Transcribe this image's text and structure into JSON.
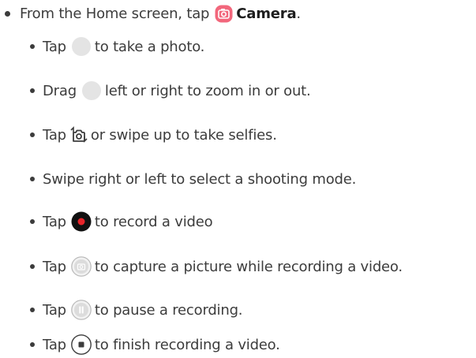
{
  "step_main": {
    "before": "From the Home screen, tap",
    "app_name": "Camera",
    "after": "."
  },
  "substeps": [
    {
      "before": "Tap",
      "after": "to take a photo.",
      "icon": "shutter-button-icon"
    },
    {
      "before": "Drag",
      "after": "left or right to zoom in or out.",
      "icon": "shutter-button-icon"
    },
    {
      "before": "Tap",
      "after": "or swipe up to take selfies.",
      "icon": "switch-camera-icon"
    },
    {
      "text": "Swipe right or left to select a shooting mode."
    },
    {
      "before": "Tap",
      "after": "to record a video",
      "icon": "record-button-icon"
    },
    {
      "before": "Tap",
      "after": "to capture a picture while recording a video.",
      "icon": "capture-button-icon"
    },
    {
      "before": "Tap",
      "after": "to pause a recording.",
      "icon": "pause-button-icon"
    },
    {
      "before": "Tap",
      "after": "to finish recording a video.",
      "icon": "stop-button-icon"
    }
  ],
  "colors": {
    "text": "#3c3c3c",
    "camera_app_icon": "#f2677c",
    "record_red": "#e8242a",
    "shutter_gray": "#e4e4e4"
  }
}
